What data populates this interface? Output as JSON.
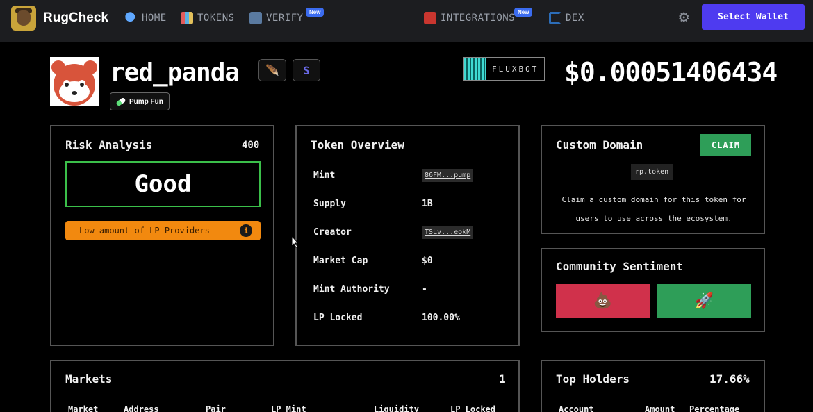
{
  "nav": {
    "brand": "RugCheck",
    "links": [
      {
        "label": "HOME",
        "icon": "search-icon"
      },
      {
        "label": "TOKENS",
        "icon": "tokens-icon"
      },
      {
        "label": "VERIFY",
        "icon": "shield-icon",
        "badge": "New"
      },
      {
        "label": "INTEGRATIONS",
        "icon": "integrations-icon",
        "badge": "New"
      },
      {
        "label": "DEX",
        "icon": "dex-icon"
      }
    ],
    "select_wallet": "Select Wallet"
  },
  "token": {
    "name": "red_panda",
    "platform": "Pump Fun",
    "fluxbot": "FLUXBOT",
    "price": "$0.00051406434"
  },
  "risk": {
    "title": "Risk Analysis",
    "score": "400",
    "rating": "Good",
    "warning": "Low amount of LP Providers",
    "info": "i"
  },
  "overview": {
    "title": "Token Overview",
    "rows": [
      {
        "label": "Mint",
        "value": "86FM...pump"
      },
      {
        "label": "Supply",
        "value": "1B"
      },
      {
        "label": "Creator",
        "value": "TSLv...eokM"
      },
      {
        "label": "Market Cap",
        "value": "$0"
      },
      {
        "label": "Mint Authority",
        "value": "-"
      },
      {
        "label": "LP Locked",
        "value": "100.00%"
      }
    ]
  },
  "domain": {
    "title": "Custom Domain",
    "claim": "CLAIM",
    "tag": "rp.token",
    "description": "Claim a custom domain for this token for users to use across the ecosystem."
  },
  "sentiment": {
    "title": "Community Sentiment",
    "bear": "💩",
    "bull": "🚀"
  },
  "markets": {
    "title": "Markets",
    "count": "1",
    "columns": [
      "Market",
      "Address",
      "Pair",
      "LP Mint",
      "Liquidity",
      "LP Locked"
    ]
  },
  "holders": {
    "title": "Top Holders",
    "pct": "17.66%",
    "columns": [
      "Account",
      "Amount",
      "Percentage"
    ]
  },
  "colors": {
    "accent": "#4e3bf0",
    "good": "#3bbf4a",
    "warning": "#f2890f",
    "bear": "#d0314b",
    "bull": "#2e9e58"
  }
}
